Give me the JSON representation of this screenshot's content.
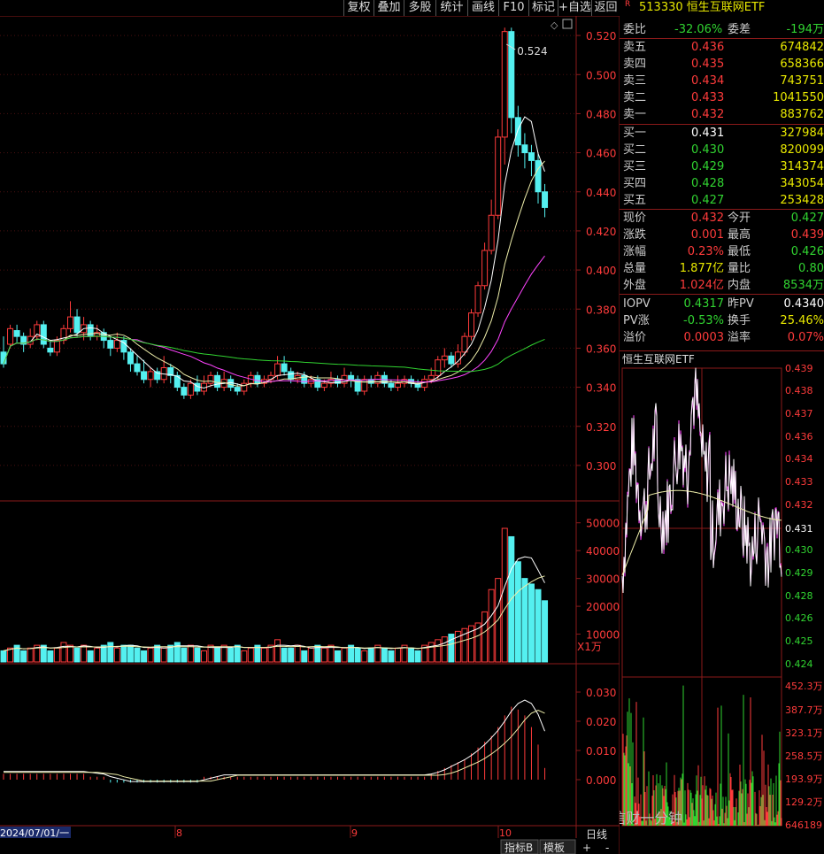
{
  "toolbar": {
    "buttons": [
      "复权",
      "叠加",
      "多股",
      "统计",
      "画线",
      "F10",
      "标记",
      "+自选",
      "返回"
    ]
  },
  "main": {
    "price_axis": [
      "0.520",
      "0.500",
      "0.480",
      "0.460",
      "0.440",
      "0.420",
      "0.400",
      "0.380",
      "0.360",
      "0.340",
      "0.320",
      "0.300"
    ],
    "high_label": "0.524",
    "vol_axis": [
      "50000",
      "40000",
      "30000",
      "20000",
      "10000"
    ],
    "vol_unit": "X1万",
    "macd_axis": [
      "0.030",
      "0.020",
      "0.010",
      "0.000"
    ],
    "date_labels": [
      "2024/07/01/一",
      "8",
      "9",
      "10"
    ],
    "period_label": "日线",
    "bottom_tabs": [
      "指标B",
      "模板"
    ]
  },
  "quote": {
    "code": "513330",
    "name": "恒生互联网ETF",
    "weibi_label": "委比",
    "weibi": "-32.06%",
    "weicha_label": "委差",
    "weicha": "-194万",
    "asks": [
      {
        "label": "卖五",
        "price": "0.436",
        "vol": "674842"
      },
      {
        "label": "卖四",
        "price": "0.435",
        "vol": "658366"
      },
      {
        "label": "卖三",
        "price": "0.434",
        "vol": "743751"
      },
      {
        "label": "卖二",
        "price": "0.433",
        "vol": "1041550"
      },
      {
        "label": "卖一",
        "price": "0.432",
        "vol": "883762"
      }
    ],
    "bids": [
      {
        "label": "买一",
        "price": "0.431",
        "vol": "327984"
      },
      {
        "label": "买二",
        "price": "0.430",
        "vol": "820099"
      },
      {
        "label": "买三",
        "price": "0.429",
        "vol": "314374"
      },
      {
        "label": "买四",
        "price": "0.428",
        "vol": "343054"
      },
      {
        "label": "买五",
        "price": "0.427",
        "vol": "253428"
      }
    ],
    "stats": [
      {
        "l1": "现价",
        "v1": "0.432",
        "c1": "red",
        "l2": "今开",
        "v2": "0.427",
        "c2": "green"
      },
      {
        "l1": "涨跌",
        "v1": "0.001",
        "c1": "red",
        "l2": "最高",
        "v2": "0.439",
        "c2": "red"
      },
      {
        "l1": "涨幅",
        "v1": "0.23%",
        "c1": "red",
        "l2": "最低",
        "v2": "0.426",
        "c2": "green"
      },
      {
        "l1": "总量",
        "v1": "1.877亿",
        "c1": "yellow",
        "l2": "量比",
        "v2": "0.80",
        "c2": "green"
      },
      {
        "l1": "外盘",
        "v1": "1.024亿",
        "c1": "red",
        "l2": "内盘",
        "v2": "8534万",
        "c2": "green"
      },
      {
        "l1": "IOPV",
        "v1": "0.4317",
        "c1": "green",
        "l2": "昨PV",
        "v2": "0.4340",
        "c2": "white"
      },
      {
        "l1": "PV涨",
        "v1": "-0.53%",
        "c1": "green",
        "l2": "换手",
        "v2": "25.46%",
        "c2": "yellow"
      },
      {
        "l1": "溢价",
        "v1": "0.0003",
        "c1": "red",
        "l2": "溢率",
        "v2": "0.07%",
        "c2": "red"
      }
    ]
  },
  "intraday": {
    "title": "恒生互联网ETF",
    "price_axis": [
      "0.439",
      "0.438",
      "0.437",
      "0.436",
      "0.434",
      "0.433",
      "0.432",
      "0.431",
      "0.430",
      "0.429",
      "0.428",
      "0.426",
      "0.425",
      "0.424"
    ],
    "vol_axis": [
      "452.3万",
      "387.7万",
      "323.1万",
      "258.5万",
      "193.9万",
      "129.2万",
      "646189"
    ],
    "watermark": "公众号 · 信财一分钟"
  },
  "colors": {
    "up": "#ff3b3b",
    "down": "#54f0f0",
    "ma5": "#ffffff",
    "ma10": "#f0f000",
    "ma20": "#ff44ff",
    "ma60": "#31d431",
    "grid": "#8b1a1a"
  },
  "chart_data": {
    "type": "candlestick",
    "ylim": [
      0.29,
      0.53
    ],
    "candles": [
      [
        0.358,
        0.352,
        0.366,
        0.35
      ],
      [
        0.362,
        0.37,
        0.372,
        0.36
      ],
      [
        0.369,
        0.366,
        0.372,
        0.363
      ],
      [
        0.366,
        0.362,
        0.368,
        0.358
      ],
      [
        0.362,
        0.366,
        0.37,
        0.36
      ],
      [
        0.366,
        0.372,
        0.374,
        0.364
      ],
      [
        0.372,
        0.362,
        0.374,
        0.36
      ],
      [
        0.36,
        0.358,
        0.364,
        0.356
      ],
      [
        0.358,
        0.364,
        0.366,
        0.356
      ],
      [
        0.364,
        0.37,
        0.372,
        0.362
      ],
      [
        0.37,
        0.376,
        0.384,
        0.368
      ],
      [
        0.376,
        0.368,
        0.38,
        0.366
      ],
      [
        0.368,
        0.372,
        0.376,
        0.364
      ],
      [
        0.372,
        0.366,
        0.374,
        0.364
      ],
      [
        0.366,
        0.368,
        0.372,
        0.364
      ],
      [
        0.368,
        0.364,
        0.37,
        0.36
      ],
      [
        0.364,
        0.36,
        0.366,
        0.356
      ],
      [
        0.36,
        0.364,
        0.368,
        0.358
      ],
      [
        0.364,
        0.358,
        0.366,
        0.354
      ],
      [
        0.358,
        0.352,
        0.36,
        0.348
      ],
      [
        0.352,
        0.348,
        0.356,
        0.346
      ],
      [
        0.348,
        0.344,
        0.354,
        0.342
      ],
      [
        0.344,
        0.348,
        0.35,
        0.34
      ],
      [
        0.348,
        0.344,
        0.35,
        0.342
      ],
      [
        0.344,
        0.35,
        0.356,
        0.342
      ],
      [
        0.35,
        0.346,
        0.352,
        0.342
      ],
      [
        0.346,
        0.34,
        0.348,
        0.338
      ],
      [
        0.34,
        0.336,
        0.342,
        0.334
      ],
      [
        0.336,
        0.342,
        0.344,
        0.334
      ],
      [
        0.342,
        0.338,
        0.346,
        0.336
      ],
      [
        0.338,
        0.342,
        0.346,
        0.336
      ],
      [
        0.342,
        0.346,
        0.348,
        0.34
      ],
      [
        0.346,
        0.34,
        0.348,
        0.338
      ],
      [
        0.34,
        0.344,
        0.348,
        0.338
      ],
      [
        0.344,
        0.34,
        0.346,
        0.338
      ],
      [
        0.34,
        0.338,
        0.342,
        0.336
      ],
      [
        0.338,
        0.342,
        0.344,
        0.336
      ],
      [
        0.342,
        0.346,
        0.348,
        0.34
      ],
      [
        0.346,
        0.342,
        0.348,
        0.34
      ],
      [
        0.342,
        0.344,
        0.346,
        0.34
      ],
      [
        0.344,
        0.346,
        0.348,
        0.342
      ],
      [
        0.346,
        0.352,
        0.356,
        0.344
      ],
      [
        0.352,
        0.348,
        0.356,
        0.346
      ],
      [
        0.348,
        0.344,
        0.35,
        0.342
      ],
      [
        0.344,
        0.346,
        0.348,
        0.342
      ],
      [
        0.346,
        0.342,
        0.348,
        0.34
      ],
      [
        0.342,
        0.344,
        0.346,
        0.34
      ],
      [
        0.344,
        0.34,
        0.346,
        0.338
      ],
      [
        0.34,
        0.342,
        0.344,
        0.338
      ],
      [
        0.342,
        0.344,
        0.348,
        0.34
      ],
      [
        0.344,
        0.342,
        0.346,
        0.34
      ],
      [
        0.342,
        0.346,
        0.35,
        0.34
      ],
      [
        0.346,
        0.344,
        0.348,
        0.34
      ],
      [
        0.344,
        0.338,
        0.346,
        0.336
      ],
      [
        0.338,
        0.344,
        0.346,
        0.336
      ],
      [
        0.344,
        0.342,
        0.346,
        0.34
      ],
      [
        0.342,
        0.346,
        0.348,
        0.34
      ],
      [
        0.346,
        0.342,
        0.348,
        0.34
      ],
      [
        0.342,
        0.34,
        0.344,
        0.338
      ],
      [
        0.34,
        0.342,
        0.346,
        0.338
      ],
      [
        0.342,
        0.344,
        0.346,
        0.34
      ],
      [
        0.344,
        0.342,
        0.346,
        0.34
      ],
      [
        0.342,
        0.34,
        0.344,
        0.338
      ],
      [
        0.34,
        0.344,
        0.346,
        0.338
      ],
      [
        0.344,
        0.346,
        0.35,
        0.342
      ],
      [
        0.346,
        0.354,
        0.356,
        0.344
      ],
      [
        0.354,
        0.356,
        0.36,
        0.35
      ],
      [
        0.356,
        0.352,
        0.358,
        0.35
      ],
      [
        0.352,
        0.358,
        0.362,
        0.35
      ],
      [
        0.358,
        0.366,
        0.368,
        0.356
      ],
      [
        0.366,
        0.378,
        0.38,
        0.364
      ],
      [
        0.378,
        0.392,
        0.394,
        0.376
      ],
      [
        0.392,
        0.41,
        0.414,
        0.39
      ],
      [
        0.41,
        0.428,
        0.436,
        0.408
      ],
      [
        0.428,
        0.468,
        0.472,
        0.426
      ],
      [
        0.468,
        0.522,
        0.524,
        0.454
      ],
      [
        0.522,
        0.478,
        0.524,
        0.47
      ],
      [
        0.478,
        0.464,
        0.484,
        0.458
      ],
      [
        0.464,
        0.46,
        0.47,
        0.452
      ],
      [
        0.46,
        0.456,
        0.464,
        0.448
      ],
      [
        0.456,
        0.44,
        0.46,
        0.434
      ],
      [
        0.44,
        0.432,
        0.444,
        0.427
      ]
    ],
    "volumes": [
      4,
      5,
      6,
      4,
      5,
      6,
      6,
      4,
      5,
      7,
      6,
      5,
      6,
      4,
      5,
      6,
      7,
      5,
      6,
      6,
      5,
      4,
      5,
      6,
      5,
      6,
      7,
      5,
      6,
      5,
      4,
      6,
      5,
      6,
      5,
      6,
      4,
      5,
      6,
      5,
      6,
      8,
      5,
      5,
      6,
      4,
      5,
      6,
      5,
      6,
      4,
      5,
      6,
      5,
      4,
      5,
      6,
      5,
      4,
      5,
      6,
      5,
      4,
      6,
      7,
      8,
      9,
      10,
      11,
      12,
      13,
      14,
      18,
      26,
      30,
      48,
      45,
      36,
      30,
      28,
      26,
      22
    ],
    "macd_hist": [
      0.002,
      0.002,
      0.002,
      0.002,
      0.002,
      0.002,
      0.002,
      0.002,
      0.002,
      0.002,
      0.002,
      0.002,
      0.002,
      0.001,
      0.001,
      0.001,
      -0.001,
      -0.001,
      -0.001,
      -0.001,
      -0.001,
      -0.001,
      -0.001,
      -0.001,
      -0.001,
      -0.001,
      -0.001,
      -0.001,
      -0.001,
      -0.001,
      0.001,
      0.001,
      0.001,
      0.001,
      0.001,
      0.001,
      0.001,
      0.001,
      0.001,
      0.001,
      0.001,
      0.001,
      0.001,
      0.001,
      0.001,
      0.001,
      0.001,
      0.001,
      0.001,
      0.001,
      0.001,
      0.001,
      0.001,
      0.001,
      0.001,
      0.001,
      0.001,
      0.001,
      0.001,
      0.001,
      0.001,
      0.001,
      0.001,
      0.001,
      0.002,
      0.003,
      0.004,
      0.005,
      0.006,
      0.007,
      0.009,
      0.011,
      0.013,
      0.015,
      0.018,
      0.022,
      0.025,
      0.024,
      0.022,
      0.018,
      0.012,
      0.004
    ]
  }
}
